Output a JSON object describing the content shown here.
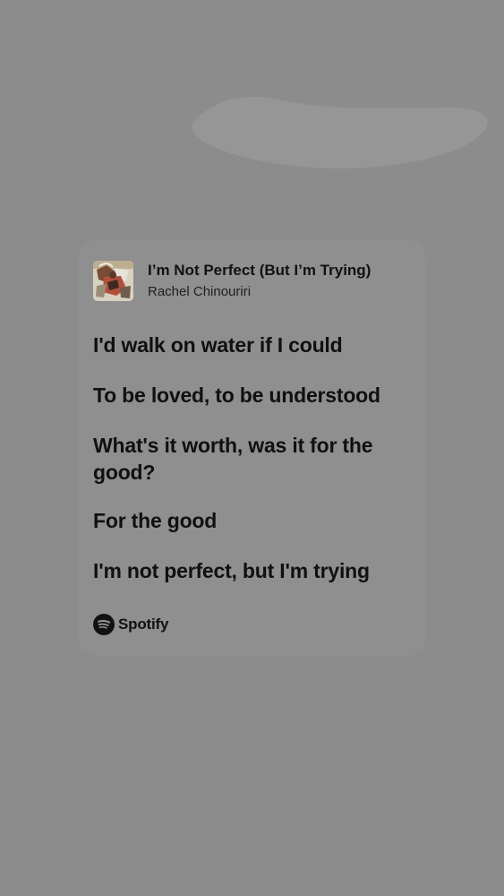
{
  "card": {
    "song_title": "I’m Not Perfect (But I’m Trying)",
    "artist": "Rachel Chinouriri",
    "lyrics": [
      "I'd walk on water if I could",
      "To be loved, to be understood",
      "What's it worth, was it for the good?",
      "For the good",
      "I'm not perfect, but I'm trying"
    ],
    "brand_label": "Spotify",
    "brand_icon": "spotify-logo-icon"
  },
  "colors": {
    "background": "#8c8c8c",
    "card": "#8f8f8f",
    "text": "#111111"
  }
}
